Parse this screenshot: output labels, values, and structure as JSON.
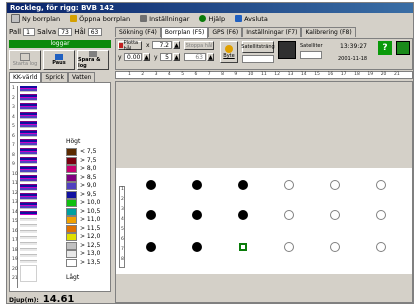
{
  "window": {
    "title": "Rockleg, för rigg: BVB 142"
  },
  "menu": [
    {
      "label": "Ny borrplan",
      "icon": "new-plan-icon",
      "color": "#c0c0c0"
    },
    {
      "label": "Öppna borrplan",
      "icon": "open-folder-icon",
      "color": "#d4a000"
    },
    {
      "label": "Inställningar",
      "icon": "settings-icon",
      "color": "#707070"
    },
    {
      "label": "Hjälp",
      "icon": "help-icon",
      "color": "#0a7c0a"
    },
    {
      "label": "Avsluta",
      "icon": "exit-icon",
      "color": "#2060c0"
    }
  ],
  "left": {
    "pall_label": "Pall",
    "pall_value": "1",
    "salva_label": "Salva",
    "salva_value": "73",
    "hal_label": "Hål",
    "hal_value": "63",
    "status_badge": "loggar",
    "buttons": [
      "Starta log",
      "Paus",
      "Spara & log"
    ],
    "tabs": [
      "KK-värld",
      "Sprick",
      "Vatten"
    ],
    "scale_high": "Högt",
    "scale_low": "Lågt",
    "legend": [
      {
        "label": "< 7,5",
        "color": "#5a2a00"
      },
      {
        "label": "> 7,5",
        "color": "#7a0010"
      },
      {
        "label": "> 8,0",
        "color": "#c80070"
      },
      {
        "label": "> 8,5",
        "color": "#800080"
      },
      {
        "label": "> 9,0",
        "color": "#5040c0"
      },
      {
        "label": "> 9,5",
        "color": "#1010a0"
      },
      {
        "label": "> 10,0",
        "color": "#10c010"
      },
      {
        "label": "> 10,5",
        "color": "#00a0a0"
      },
      {
        "label": "> 11,0",
        "color": "#f0a000"
      },
      {
        "label": "> 11,5",
        "color": "#e07000"
      },
      {
        "label": "> 12,0",
        "color": "#e0e000"
      },
      {
        "label": "> 12,5",
        "color": "#c0c0c0"
      },
      {
        "label": "> 13,0",
        "color": "#e8e8e8"
      },
      {
        "label": "> 13,5",
        "color": "#ffffff"
      }
    ],
    "ruler_numbers": [
      "1",
      "2",
      "3",
      "4",
      "5",
      "6",
      "7",
      "8",
      "9",
      "10",
      "11",
      "12",
      "13",
      "14",
      "15",
      "16",
      "17",
      "18",
      "19",
      "20",
      "21"
    ],
    "depth_label": "Djup(m):",
    "depth_value": "14.61"
  },
  "tabs": [
    {
      "label": "Sökning (F4)",
      "active": false
    },
    {
      "label": "Borrplan (F5)",
      "active": true
    },
    {
      "label": "GPS (F6)",
      "active": false
    },
    {
      "label": "Inställningar (F7)",
      "active": false
    },
    {
      "label": "Kalibrering (F8)",
      "active": false
    }
  ],
  "toolbar": {
    "plotta_label": "Plotta hål",
    "x_label": "x",
    "x_value": "7.2",
    "y_label": "y",
    "y_value": "5",
    "y2_label": "y",
    "y2_value": "0.00",
    "x2_label": "x",
    "x2_value": "63",
    "byte_label": "Byte",
    "satellite_label": "Satellitsträng",
    "satellites_label": "Satelliter",
    "time": "13:39:27",
    "date": "2001-11-18",
    "pause_button": "Stoppa hål"
  },
  "plan": {
    "top_ruler": [
      "1",
      "2",
      "3",
      "4",
      "5",
      "6",
      "7",
      "8",
      "9",
      "10",
      "11",
      "12",
      "13",
      "14",
      "15",
      "16",
      "17",
      "18",
      "19",
      "20",
      "21"
    ],
    "left_ruler": [
      "1",
      "2",
      "3",
      "4",
      "5",
      "6",
      "7",
      "8"
    ],
    "rows": [
      [
        "filled",
        "filled",
        "filled",
        "empty",
        "empty",
        "empty"
      ],
      [
        "filled",
        "filled",
        "filled",
        "empty",
        "empty",
        "empty"
      ],
      [
        "filled",
        "filled",
        "selected",
        "empty",
        "empty",
        "empty"
      ]
    ]
  }
}
